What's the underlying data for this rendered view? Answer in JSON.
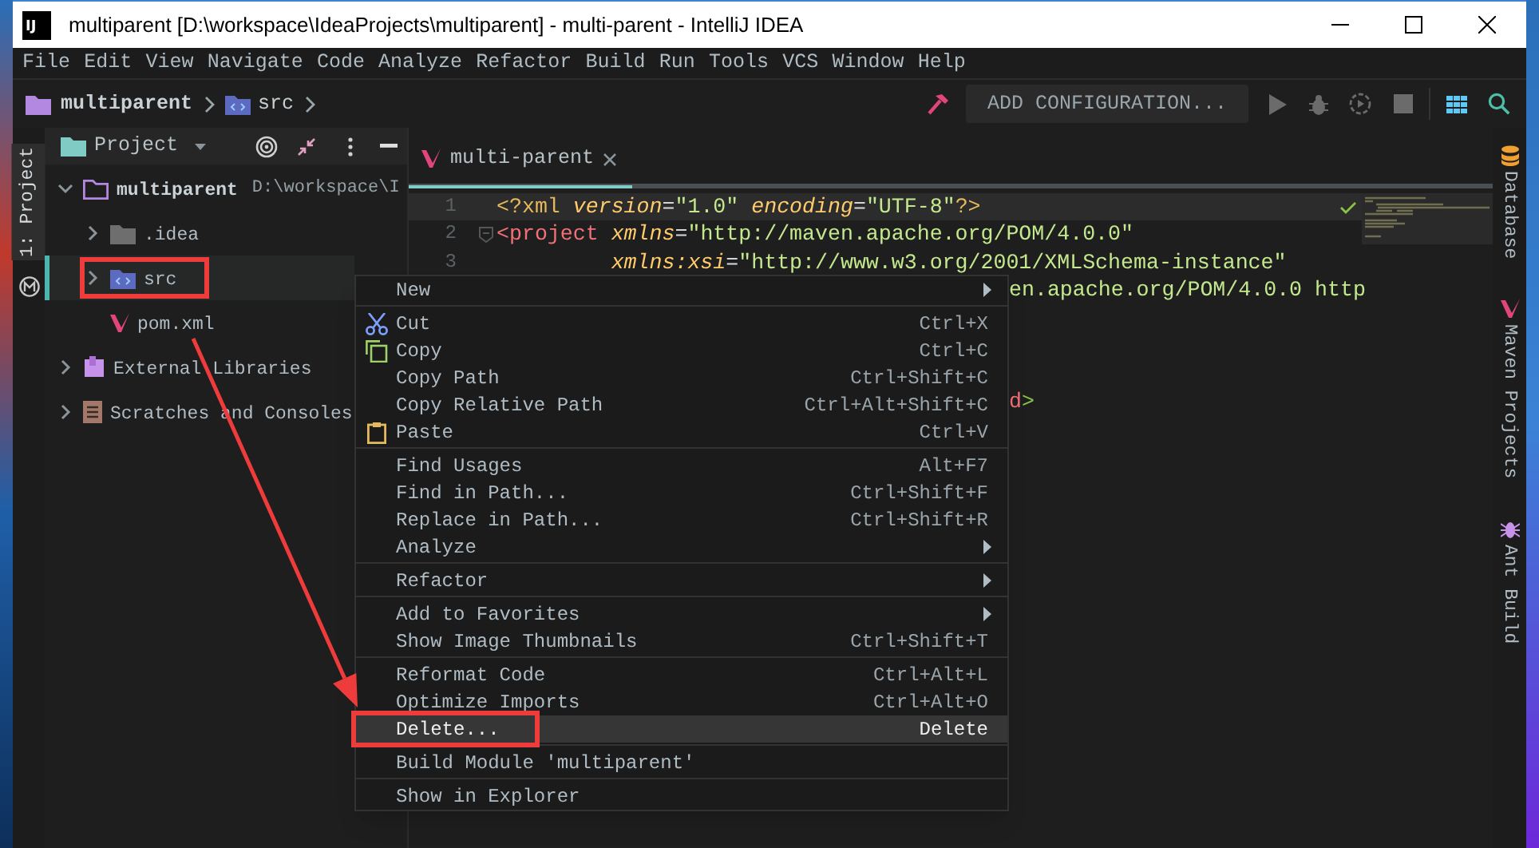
{
  "window": {
    "logo": "IJ",
    "title": "multiparent [D:\\workspace\\IdeaProjects\\multiparent] - multi-parent - IntelliJ IDEA"
  },
  "menu_bar": [
    "File",
    "Edit",
    "View",
    "Navigate",
    "Code",
    "Analyze",
    "Refactor",
    "Build",
    "Run",
    "Tools",
    "VCS",
    "Window",
    "Help"
  ],
  "breadcrumbs": [
    {
      "label": "multiparent",
      "kind": "project"
    },
    {
      "label": "src",
      "kind": "source"
    }
  ],
  "toolbar": {
    "configuration_button": "ADD CONFIGURATION..."
  },
  "left_stripe": [
    {
      "label": "1: Project",
      "selected": true
    }
  ],
  "project_panel": {
    "title": "Project",
    "tree": [
      {
        "label": "multiparent",
        "path": "D:\\workspace\\I",
        "kind": "module",
        "expanded": true,
        "selected": false,
        "annotated": false,
        "children": [
          {
            "label": ".idea",
            "kind": "folder",
            "expanded": false,
            "selected": false,
            "annotated": false
          },
          {
            "label": "src",
            "kind": "source",
            "expanded": false,
            "selected": true,
            "annotated": true
          },
          {
            "label": "pom.xml",
            "kind": "maven",
            "selected": false,
            "annotated": false
          }
        ]
      },
      {
        "label": "External Libraries",
        "kind": "libraries",
        "expanded": false,
        "selected": false,
        "annotated": false
      },
      {
        "label": "Scratches and Consoles",
        "kind": "scratches",
        "expanded": false,
        "selected": false,
        "annotated": false
      }
    ]
  },
  "editor": {
    "tabs": [
      {
        "label": "multi-parent",
        "selected": true
      }
    ],
    "lines": [
      {
        "number": "1",
        "kind": "code",
        "current": true,
        "segments": [
          {
            "text": "<?xml",
            "kind": "prolog"
          },
          {
            "text": " version",
            "kind": "attr"
          },
          {
            "text": "=",
            "kind": "eq"
          },
          {
            "text": "\"1.0\"",
            "kind": "string"
          },
          {
            "text": " encoding",
            "kind": "attr"
          },
          {
            "text": "=",
            "kind": "eq"
          },
          {
            "text": "\"UTF-8\"",
            "kind": "string"
          },
          {
            "text": "?>",
            "kind": "prolog"
          }
        ]
      },
      {
        "number": "2",
        "kind": "code",
        "current": false,
        "segments": [
          {
            "text": "<project",
            "kind": "tag"
          },
          {
            "text": " xmlns",
            "kind": "attr"
          },
          {
            "text": "=",
            "kind": "eq"
          },
          {
            "text": "\"http://maven.apache.org/POM/4.0.0\"",
            "kind": "string"
          }
        ]
      },
      {
        "number": "3",
        "kind": "code",
        "current": false,
        "segments": [
          {
            "text": "         xmlns:xsi",
            "kind": "attr"
          },
          {
            "text": "=",
            "kind": "eq"
          },
          {
            "text": "\"http://www.w3.org/2001/XMLSchema-instance\"",
            "kind": "string"
          }
        ]
      },
      {
        "kind": "tail",
        "current": false,
        "segments": [
          {
            "text": "en.apache.org/POM/4.0.0 http",
            "kind": "string"
          }
        ]
      },
      {
        "kind": "hidden",
        "current": false
      },
      {
        "kind": "hidden",
        "current": false
      },
      {
        "kind": "hidden",
        "current": false
      },
      {
        "kind": "tail",
        "current": false,
        "segments": [
          {
            "text": "d",
            "kind": "tag"
          },
          {
            "text": ">",
            "kind": "bracket"
          }
        ]
      }
    ]
  },
  "right_stripe": [
    {
      "label": "Database",
      "kind": "database"
    },
    {
      "label": "Maven Projects",
      "kind": "maven"
    },
    {
      "label": "Ant Build",
      "kind": "ant"
    }
  ],
  "context_menu": {
    "groups": [
      [
        {
          "label": "New",
          "kind": "plain",
          "submenu": true,
          "selected": false,
          "annotated": false
        }
      ],
      [
        {
          "label": "Cut",
          "shortcut": "Ctrl+X",
          "kind": "cut",
          "submenu": false,
          "selected": false,
          "annotated": false
        },
        {
          "label": "Copy",
          "shortcut": "Ctrl+C",
          "kind": "copy",
          "submenu": false,
          "selected": false,
          "annotated": false
        },
        {
          "label": "Copy Path",
          "shortcut": "Ctrl+Shift+C",
          "kind": "plain",
          "submenu": false,
          "selected": false,
          "annotated": false
        },
        {
          "label": "Copy Relative Path",
          "shortcut": "Ctrl+Alt+Shift+C",
          "kind": "plain",
          "submenu": false,
          "selected": false,
          "annotated": false
        },
        {
          "label": "Paste",
          "shortcut": "Ctrl+V",
          "kind": "paste",
          "submenu": false,
          "selected": false,
          "annotated": false
        }
      ],
      [
        {
          "label": "Find Usages",
          "shortcut": "Alt+F7",
          "kind": "plain",
          "submenu": false,
          "selected": false,
          "annotated": false
        },
        {
          "label": "Find in Path...",
          "shortcut": "Ctrl+Shift+F",
          "kind": "plain",
          "submenu": false,
          "selected": false,
          "annotated": false
        },
        {
          "label": "Replace in Path...",
          "shortcut": "Ctrl+Shift+R",
          "kind": "plain",
          "submenu": false,
          "selected": false,
          "annotated": false
        },
        {
          "label": "Analyze",
          "kind": "plain",
          "submenu": true,
          "selected": false,
          "annotated": false
        }
      ],
      [
        {
          "label": "Refactor",
          "kind": "plain",
          "submenu": true,
          "selected": false,
          "annotated": false
        }
      ],
      [
        {
          "label": "Add to Favorites",
          "kind": "plain",
          "submenu": true,
          "selected": false,
          "annotated": false
        },
        {
          "label": "Show Image Thumbnails",
          "shortcut": "Ctrl+Shift+T",
          "kind": "plain",
          "submenu": false,
          "selected": false,
          "annotated": false
        }
      ],
      [
        {
          "label": "Reformat Code",
          "shortcut": "Ctrl+Alt+L",
          "kind": "plain",
          "submenu": false,
          "selected": false,
          "annotated": false
        },
        {
          "label": "Optimize Imports",
          "shortcut": "Ctrl+Alt+O",
          "kind": "plain",
          "submenu": false,
          "selected": false,
          "annotated": false
        },
        {
          "label": "Delete...",
          "shortcut": "Delete",
          "kind": "plain",
          "submenu": false,
          "selected": true,
          "annotated": true
        }
      ],
      [
        {
          "label": "Build Module 'multiparent'",
          "kind": "plain",
          "submenu": false,
          "selected": false,
          "annotated": false
        }
      ],
      [
        {
          "label": "Show in Explorer",
          "kind": "plain",
          "submenu": false,
          "selected": false,
          "annotated": false
        }
      ]
    ]
  }
}
